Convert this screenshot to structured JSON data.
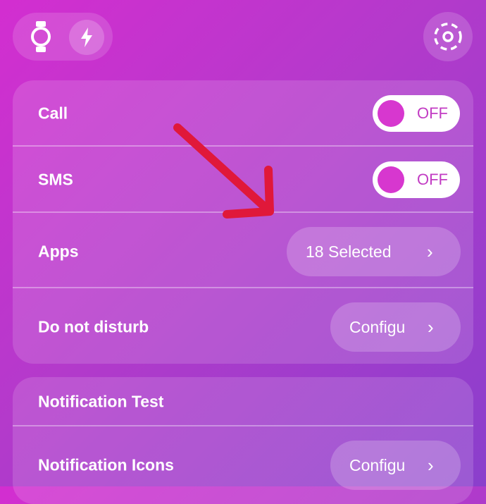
{
  "topbar": {
    "watch_icon": "watch-icon",
    "bolt_icon": "bolt-icon",
    "settings_icon": "settings-dashed-circle-icon"
  },
  "notifications_card": {
    "rows": [
      {
        "label": "Call",
        "control": "toggle",
        "value": "OFF",
        "on": false
      },
      {
        "label": "SMS",
        "control": "toggle",
        "value": "OFF",
        "on": false
      },
      {
        "label": "Apps",
        "control": "pill",
        "value": "18 Selected"
      },
      {
        "label": "Do not disturb",
        "control": "pill",
        "value": "Configu"
      }
    ]
  },
  "tools_card": {
    "rows": [
      {
        "label": "Notification Test"
      },
      {
        "label": "Notification Icons",
        "control": "pill",
        "value": "Configu"
      }
    ]
  },
  "overlay": {
    "arrow_color": "#e0183a"
  },
  "colors": {
    "accent": "#d737cf",
    "background_start": "#d32ed0",
    "background_end": "#8a3fcc"
  }
}
